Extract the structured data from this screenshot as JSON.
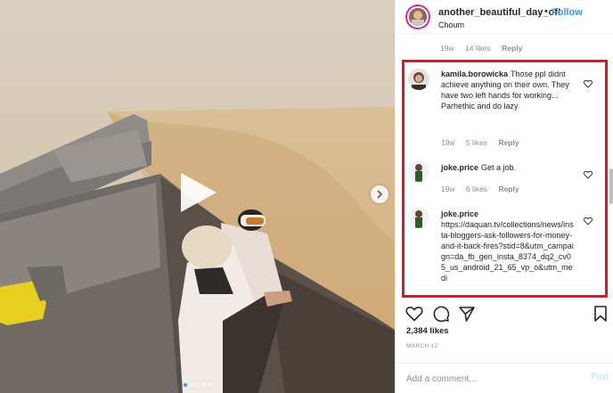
{
  "post": {
    "username": "another_beautiful_day_of!",
    "separator": "•",
    "follow_label": "Follow",
    "location": "Choum"
  },
  "top_comment_meta": {
    "time": "19w",
    "likes": "14 likes",
    "reply": "Reply"
  },
  "comments": [
    {
      "username": "kamila.borowicka",
      "text": "Those ppl didnt achieve anything on their own. They have two left hands for working... Parhethic and do lazy",
      "time": "19w",
      "likes": "5 likes",
      "reply": "Reply"
    },
    {
      "username": "joke.price",
      "text": "Get a job.",
      "time": "19w",
      "likes": "6 likes",
      "reply": "Reply"
    },
    {
      "username": "joke.price",
      "text": "https://daquan.tv/collections/news/insta-bloggers-ask-followers-for-money-and-it-back-fires?stid=8&utm_campaign=da_fb_gen_insta_8374_dq2_cv05_us_android_21_65_vp_o&utm_medi"
    }
  ],
  "likes_count": "2,384 likes",
  "date": "MARCH 12",
  "add_comment": {
    "placeholder": "Add a comment...",
    "post_label": "Post"
  },
  "media": {
    "carousel_dots": 5,
    "active_dot": 0
  },
  "colors": {
    "accent": "#3897f0",
    "highlight_border": "#e5141d",
    "muted": "#8e8e8e",
    "text": "#262626"
  },
  "icons": [
    "play-icon",
    "chevron-right-icon",
    "heart-icon",
    "comment-icon",
    "share-icon",
    "bookmark-icon"
  ]
}
